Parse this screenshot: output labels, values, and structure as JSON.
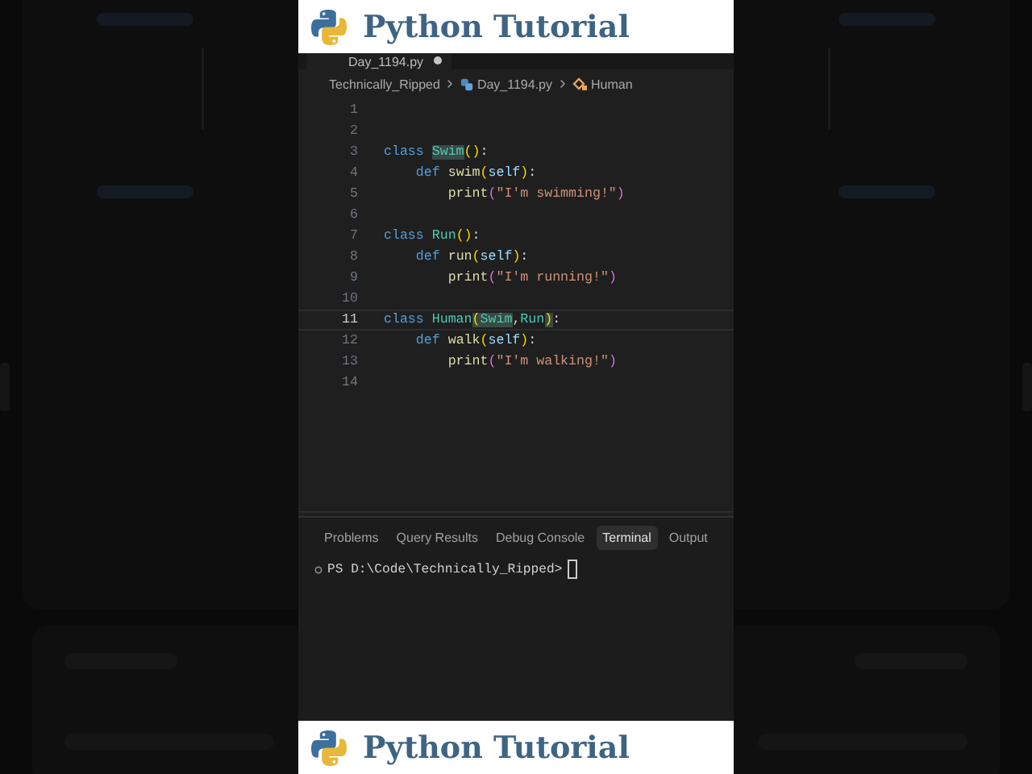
{
  "banners": [
    {
      "title": "Python Tutorial"
    },
    {
      "title": "Python Tutorial"
    }
  ],
  "editor": {
    "tab": {
      "label": "Day_1194.py",
      "modified": true
    },
    "breadcrumb": [
      {
        "label": "Technically_Ripped",
        "kind": "folder"
      },
      {
        "label": "Day_1194.py",
        "kind": "file"
      },
      {
        "label": "Human",
        "kind": "class"
      }
    ],
    "lines": [
      {
        "number": "1",
        "current": false
      },
      {
        "number": "2",
        "current": false
      },
      {
        "number": "3",
        "current": false,
        "tokens": [
          {
            "text": "class ",
            "kind": "keyword"
          },
          {
            "text": "Swim",
            "kind": "class",
            "highlighted": true
          },
          {
            "text": "()",
            "kind": "paren"
          },
          {
            "text": ":",
            "kind": "plain"
          }
        ]
      },
      {
        "number": "4",
        "current": false,
        "tokens": [
          {
            "text": "    def ",
            "kind": "keyword"
          },
          {
            "text": "swim",
            "kind": "function"
          },
          {
            "text": "(",
            "kind": "paren"
          },
          {
            "text": "self",
            "kind": "param"
          },
          {
            "text": ")",
            "kind": "paren"
          },
          {
            "text": ":",
            "kind": "plain"
          }
        ]
      },
      {
        "number": "5",
        "current": false,
        "tokens": [
          {
            "text": "        print",
            "kind": "function"
          },
          {
            "text": "(",
            "kind": "paren2"
          },
          {
            "text": "\"I'm swimming!\"",
            "kind": "string"
          },
          {
            "text": ")",
            "kind": "paren2"
          }
        ]
      },
      {
        "number": "6",
        "current": false
      },
      {
        "number": "7",
        "current": false,
        "tokens": [
          {
            "text": "class ",
            "kind": "keyword"
          },
          {
            "text": "Run",
            "kind": "class"
          },
          {
            "text": "()",
            "kind": "paren"
          },
          {
            "text": ":",
            "kind": "plain"
          }
        ]
      },
      {
        "number": "8",
        "current": false,
        "tokens": [
          {
            "text": "    def ",
            "kind": "keyword"
          },
          {
            "text": "run",
            "kind": "function"
          },
          {
            "text": "(",
            "kind": "paren"
          },
          {
            "text": "self",
            "kind": "param"
          },
          {
            "text": ")",
            "kind": "paren"
          },
          {
            "text": ":",
            "kind": "plain"
          }
        ]
      },
      {
        "number": "9",
        "current": false,
        "tokens": [
          {
            "text": "        print",
            "kind": "function"
          },
          {
            "text": "(",
            "kind": "paren2"
          },
          {
            "text": "\"I'm running!\"",
            "kind": "string"
          },
          {
            "text": ")",
            "kind": "paren2"
          }
        ]
      },
      {
        "number": "10",
        "current": false
      },
      {
        "number": "11",
        "current": true,
        "tokens": [
          {
            "text": "class ",
            "kind": "keyword"
          },
          {
            "text": "Human",
            "kind": "class"
          },
          {
            "text": "(",
            "kind": "paren",
            "highlighted": true
          },
          {
            "text": "Swim",
            "kind": "class",
            "highlighted": true
          },
          {
            "text": ",",
            "kind": "plain"
          },
          {
            "text": "Run",
            "kind": "class"
          },
          {
            "text": ")",
            "kind": "paren",
            "highlighted": true
          },
          {
            "text": ":",
            "kind": "plain"
          }
        ]
      },
      {
        "number": "12",
        "current": false,
        "tokens": [
          {
            "text": "    def ",
            "kind": "keyword"
          },
          {
            "text": "walk",
            "kind": "function"
          },
          {
            "text": "(",
            "kind": "paren"
          },
          {
            "text": "self",
            "kind": "param"
          },
          {
            "text": ")",
            "kind": "paren"
          },
          {
            "text": ":",
            "kind": "plain"
          }
        ]
      },
      {
        "number": "13",
        "current": false,
        "tokens": [
          {
            "text": "        print",
            "kind": "function"
          },
          {
            "text": "(",
            "kind": "paren2"
          },
          {
            "text": "\"I'm walking!\"",
            "kind": "string"
          },
          {
            "text": ")",
            "kind": "paren2"
          }
        ]
      },
      {
        "number": "14",
        "current": false
      }
    ]
  },
  "panel": {
    "tabs": [
      {
        "label": "Problems",
        "selected": false
      },
      {
        "label": "Query Results",
        "selected": false
      },
      {
        "label": "Debug Console",
        "selected": false
      },
      {
        "label": "Terminal",
        "selected": true
      },
      {
        "label": "Output",
        "selected": false
      }
    ],
    "terminal": {
      "prompt": "PS D:\\Code\\Technically_Ripped>"
    }
  }
}
